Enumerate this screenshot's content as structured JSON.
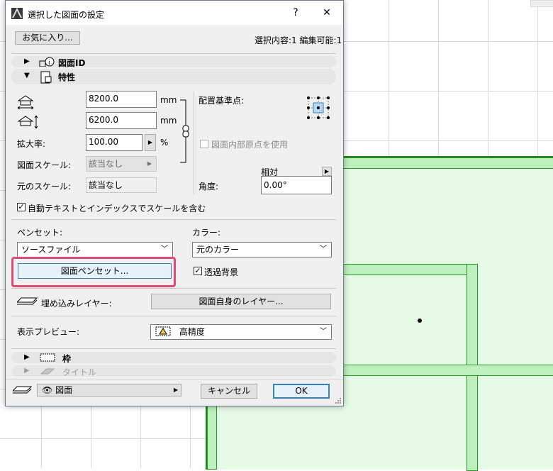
{
  "window": {
    "title": "選択した図面の設定",
    "help_glyph": "?",
    "close_glyph": "✕"
  },
  "toolbar": {
    "favorites_label": "お気に入り...",
    "selection_info": "選択内容:1 編集可能:1"
  },
  "sections": {
    "drawing_id": "図面ID",
    "properties": "特性",
    "frame": "枠",
    "title": "タイトル"
  },
  "size": {
    "width_value": "8200.0",
    "width_unit": "mm",
    "height_value": "6200.0",
    "height_unit": "mm",
    "magnification_label": "拡大率:",
    "magnification_value": "100.00",
    "magnification_unit": "%",
    "drawing_scale_label": "図面スケール:",
    "drawing_scale_value": "該当なし",
    "original_scale_label": "元のスケール:",
    "original_scale_value": "該当なし",
    "auto_text_label": "自動テキストとインデックスでスケールを含む",
    "auto_text_checked": true
  },
  "anchor": {
    "label": "配置基準点:",
    "use_origin_label": "図面内部原点を使用",
    "use_origin_checked": false,
    "relative_label": "相対",
    "angle_label": "角度:",
    "angle_value": "0.00°"
  },
  "pen": {
    "penset_label": "ペンセット:",
    "penset_value": "ソースファイル",
    "color_label": "カラー:",
    "color_value": "元のカラー",
    "drawing_penset_button": "図面ペンセット...",
    "transparent_label": "透過背景",
    "transparent_checked": true
  },
  "layer": {
    "embedded_label": "埋め込みレイヤー:",
    "own_layer_button": "図面自身のレイヤー..."
  },
  "preview": {
    "label": "表示プレビュー:",
    "value": "高精度"
  },
  "footer": {
    "layer_value": "図面",
    "cancel_label": "キャンセル",
    "ok_label": "OK"
  },
  "colors": {
    "highlight": "#e04a76",
    "plan_fill": "#e6fbe6",
    "plan_stroke": "#1a8a1a"
  }
}
